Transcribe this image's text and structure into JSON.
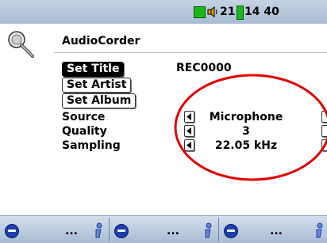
{
  "status": {
    "volume": "21",
    "time": "14 40"
  },
  "header": {
    "title": "AudioCorder"
  },
  "buttons": {
    "set_title": "Set Title",
    "set_artist": "Set Artist",
    "set_album": "Set Album"
  },
  "title_value": "REC0000",
  "params": [
    {
      "label": "Source",
      "value": "Microphone"
    },
    {
      "label": "Quality",
      "value": "3"
    },
    {
      "label": "Sampling",
      "value": "22.05 kHz"
    }
  ],
  "softkeys": [
    {
      "icon": "minus-circle-icon",
      "label": "..."
    },
    {
      "icon": "minus-circle-icon",
      "label": "..."
    },
    {
      "icon": "minus-circle-icon",
      "label": "..."
    }
  ],
  "colors": {
    "accent_blue": "#1c3fb0",
    "annotation_red": "#e00000",
    "battery_green": "#1ab81a"
  }
}
